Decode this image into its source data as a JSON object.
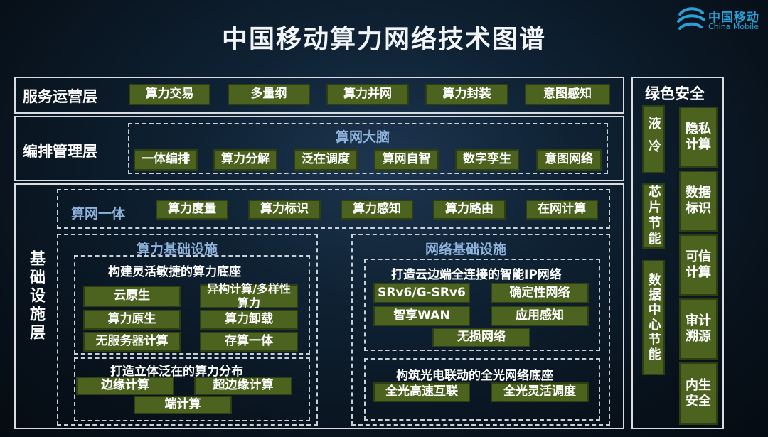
{
  "title": "中国移动算力网络技术图谱",
  "logo": {
    "cn": "中国移动",
    "en": "China Mobile"
  },
  "service_layer": {
    "label": "服务运营层",
    "items": [
      "算力交易",
      "多量纲",
      "算力并网",
      "算力封装",
      "意图感知"
    ]
  },
  "orchestration_layer": {
    "label": "编排管理层",
    "brain_title": "算网大脑",
    "items": [
      "一体编排",
      "算力分解",
      "泛在调度",
      "算网自智",
      "数字孪生",
      "意图网络"
    ]
  },
  "infra_layer": {
    "label": "基础设施层",
    "integration": {
      "title": "算网一体",
      "items": [
        "算力度量",
        "算力标识",
        "算力感知",
        "算力路由",
        "在网计算"
      ]
    },
    "compute": {
      "title": "算力基础设施",
      "base": {
        "title": "构建灵活敏捷的算力底座",
        "items": [
          "云原生",
          "异构计算/多样性算力",
          "算力原生",
          "算力卸载",
          "无服务器计算",
          "存算一体"
        ]
      },
      "distribution": {
        "title": "打造立体泛在的算力分布",
        "items": [
          "边缘计算",
          "超边缘计算",
          "端计算"
        ]
      }
    },
    "network": {
      "title": "网络基础设施",
      "ip": {
        "title": "打造云边端全连接的智能IP网络",
        "items": [
          "SRv6/G-SRv6",
          "确定性网络",
          "智享WAN",
          "应用感知",
          "无损网络"
        ]
      },
      "optical": {
        "title": "构筑光电联动的全光网络底座",
        "items": [
          "全光高速互联",
          "全光灵活调度"
        ]
      }
    }
  },
  "green_security": {
    "title": "绿色安全",
    "green": [
      "液冷",
      "芯片节能",
      "数据中心节能"
    ],
    "security": [
      "隐私计算",
      "数据标识",
      "可信计算",
      "审计溯源",
      "内生安全"
    ]
  },
  "colors": {
    "chip_fill": "#4c6320",
    "chip_border": "#2e3e12",
    "panel_border": "#d9dde2",
    "accent_blue": "#8fb3dd",
    "logo_blue": "#2aa0d6"
  }
}
